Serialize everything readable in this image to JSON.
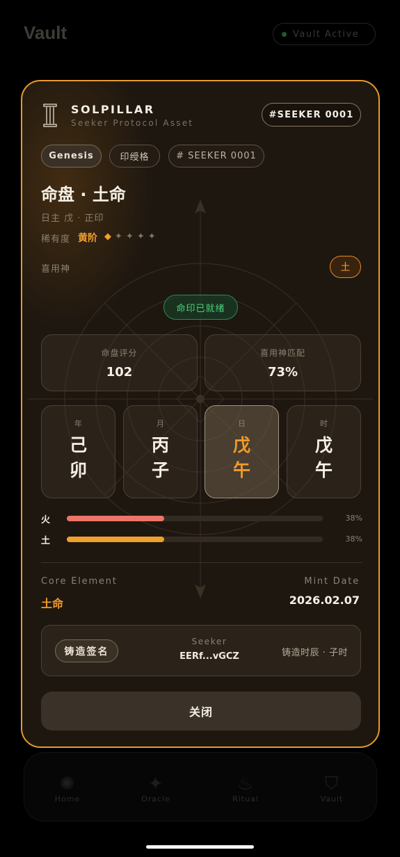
{
  "background": {
    "title": "Vault",
    "status_label": "Vault Active",
    "nav": [
      {
        "label": "Home",
        "icon": "sparkle-icon"
      },
      {
        "label": "Oracle",
        "icon": "star-icon"
      },
      {
        "label": "Ritual",
        "icon": "flame-icon"
      },
      {
        "label": "Vault",
        "icon": "shield-icon"
      }
    ]
  },
  "card": {
    "brand_name": "SOLPILLAR",
    "brand_subtitle": "Seeker Protocol Asset",
    "serial_badge": "#SEEKER 0001",
    "tags": [
      "Genesis",
      "印绶格",
      "# SEEKER 0001"
    ],
    "title": "命盘 · 土命",
    "daymaster": "日主 戊 · 正印",
    "rarity_label": "稀有度",
    "rarity_value": "黄阶",
    "rarity_stars": 1,
    "rarity_max": 5,
    "favorable_label": "喜用神",
    "favorable_value": "土",
    "ready_badge": "命印已就绪",
    "stats": [
      {
        "label": "命盘评分",
        "value": "102"
      },
      {
        "label": "喜用神匹配",
        "value": "73%"
      }
    ],
    "pillars": [
      {
        "label": "年",
        "stem": "己",
        "branch": "卯",
        "active": false
      },
      {
        "label": "月",
        "stem": "丙",
        "branch": "子",
        "active": false
      },
      {
        "label": "日",
        "stem": "戊",
        "branch": "午",
        "active": true
      },
      {
        "label": "时",
        "stem": "戊",
        "branch": "午",
        "active": false
      }
    ],
    "elements": [
      {
        "name": "火",
        "percent": "38%",
        "value": 0.38,
        "color": "#ec7468"
      },
      {
        "name": "土",
        "percent": "38%",
        "value": 0.38,
        "color": "#f0a02c"
      }
    ],
    "core_element_label": "Core Element",
    "core_element_value": "土命",
    "mint_date_label": "Mint Date",
    "mint_date_value": "2026.02.07",
    "signature_button": "铸造签名",
    "seeker_label": "Seeker",
    "seeker_value": "EERf...vGCZ",
    "mint_time": "铸造时辰 · 子时",
    "close_button": "关闭"
  },
  "colors": {
    "accent": "#e89a2c",
    "success": "#4ed07e",
    "fire": "#ec7468",
    "earth": "#f0a02c"
  }
}
